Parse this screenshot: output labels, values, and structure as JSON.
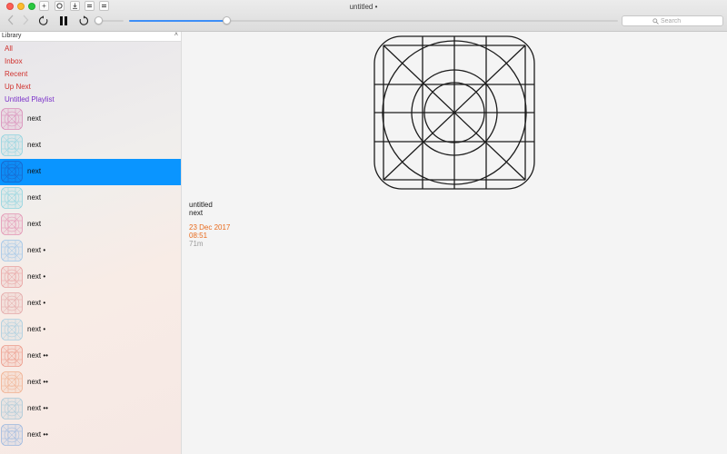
{
  "window": {
    "title": "untitled •"
  },
  "toolbar": {
    "back_icon": "chevron-left-icon",
    "forward_icon": "chevron-right-icon",
    "skip_back_icon": "skip-back-icon",
    "pause_icon": "pause-icon",
    "skip_forward_icon": "skip-forward-icon",
    "small_buttons": [
      "add-icon",
      "refresh-icon",
      "download-icon",
      "list-icon",
      "list-icon"
    ],
    "volume": 0.15,
    "progress": 0.2,
    "accent_color": "#3d8ef7"
  },
  "search": {
    "placeholder": "Search"
  },
  "sidebar": {
    "header": "Library",
    "collapse_glyph": "˄",
    "library_items": [
      "All",
      "Inbox",
      "Recent",
      "Up Next",
      "Untitled Playlist"
    ],
    "library_color": "#d0312d",
    "playlist_color": "#7a30c9",
    "rows": [
      {
        "label": "next",
        "color": "#d98ab8",
        "selected": false
      },
      {
        "label": "next",
        "color": "#8fd3df",
        "selected": false
      },
      {
        "label": "next",
        "color": "#1b63c9",
        "selected": true
      },
      {
        "label": "next",
        "color": "#8fd3df",
        "selected": false
      },
      {
        "label": "next",
        "color": "#e394b4",
        "selected": false
      },
      {
        "label": "next •",
        "color": "#9fc5e8",
        "selected": false
      },
      {
        "label": "next •",
        "color": "#e8a0a0",
        "selected": false
      },
      {
        "label": "next •",
        "color": "#e3a8a8",
        "selected": false
      },
      {
        "label": "next •",
        "color": "#a8cde0",
        "selected": false
      },
      {
        "label": "next ••",
        "color": "#ec9a8a",
        "selected": false
      },
      {
        "label": "next ••",
        "color": "#f0b090",
        "selected": false
      },
      {
        "label": "next ••",
        "color": "#a8c8d8",
        "selected": false
      },
      {
        "label": "next ••",
        "color": "#9cb8e0",
        "selected": false
      }
    ],
    "selection_color": "#0a95ff"
  },
  "detail": {
    "title": "untitled",
    "subtitle": "next",
    "date": "23 Dec 2017",
    "time": "08:51",
    "duration": "71m",
    "date_color": "#e86a1c"
  }
}
